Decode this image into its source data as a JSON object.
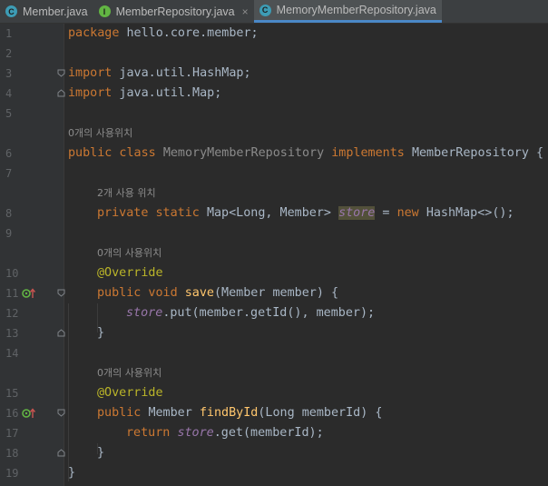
{
  "tabs": [
    {
      "label": "Member.java",
      "icon": "class-icon",
      "icon_letter": "C",
      "icon_color": "#3d9cb5",
      "active": false,
      "closable": false
    },
    {
      "label": "MemberRepository.java",
      "icon": "interface-icon",
      "icon_letter": "I",
      "icon_color": "#62b543",
      "active": false,
      "closable": true
    },
    {
      "label": "MemoryMemberRepository.java",
      "icon": "class-icon",
      "icon_letter": "C",
      "icon_color": "#3d9cb5",
      "active": true,
      "closable": false
    }
  ],
  "close_glyph": "×",
  "usage_hints": {
    "class_usages": "0개의 사용위치",
    "field_usages": "2개 사용 위치",
    "save_usages": "0개의 사용위치",
    "find_usages": "0개의 사용위치"
  },
  "line_numbers": [
    "1",
    "2",
    "3",
    "4",
    "5",
    "6",
    "7",
    "8",
    "9",
    "10",
    "11",
    "12",
    "13",
    "14",
    "15",
    "16",
    "17",
    "18",
    "19"
  ],
  "code": {
    "l1_kw": "package",
    "l1_rest": " hello.core.member;",
    "l3_kw": "import",
    "l3_rest": " java.util.HashMap;",
    "l4_kw": "import",
    "l4_rest": " java.util.Map;",
    "l6_kw1": "public class ",
    "l6_name": "MemoryMemberRepository",
    "l6_kw2": " implements ",
    "l6_rest": "MemberRepository {",
    "l8_kw": "private static ",
    "l8_type": "Map<Long, Member> ",
    "l8_field": "store",
    "l8_eq": " = ",
    "l8_new": "new ",
    "l8_rest": "HashMap<>();",
    "l10_anno": "@Override",
    "l11_kw": "public void ",
    "l11_fn": "save",
    "l11_rest": "(Member member) {",
    "l12_field": "store",
    "l12_rest": ".put(member.getId(), member);",
    "l13": "}",
    "l15_anno": "@Override",
    "l16_kw": "public ",
    "l16_type": "Member ",
    "l16_fn": "findById",
    "l16_rest": "(Long memberId) {",
    "l17_kw": "return ",
    "l17_field": "store",
    "l17_rest": ".get(memberId);",
    "l18": "}",
    "l19": "}"
  }
}
